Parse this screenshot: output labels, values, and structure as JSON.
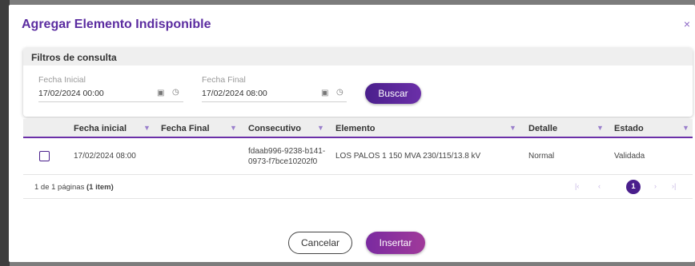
{
  "modal": {
    "title": "Agregar Elemento Indisponible",
    "close_label": "×"
  },
  "filters": {
    "title": "Filtros de consulta",
    "start_label": "Fecha Inicial",
    "start_value": "17/02/2024 00:00",
    "end_label": "Fecha Final",
    "end_value": "17/02/2024 08:00",
    "search_button": "Buscar"
  },
  "grid": {
    "columns": [
      "Fecha inicial",
      "Fecha Final",
      "Consecutivo",
      "Elemento",
      "Detalle",
      "Estado"
    ],
    "rows": [
      {
        "fecha_inicial": "17/02/2024 08:00",
        "fecha_final": "",
        "consecutivo_line1": "fdaab996-9238-b141-",
        "consecutivo_line2": "0973-f7bce10202f0",
        "elemento": "LOS PALOS 1 150 MVA 230/115/13.8 kV",
        "detalle": "Normal",
        "estado": "Validada"
      }
    ],
    "pager": {
      "text_prefix": "1 de 1 páginas ",
      "text_bold": "(1 item)",
      "current_page": "1"
    }
  },
  "footer": {
    "cancel_label": "Cancelar",
    "insert_label": "Insertar"
  },
  "colors": {
    "accent": "#4a1f8c",
    "title": "#5b2ca0"
  }
}
